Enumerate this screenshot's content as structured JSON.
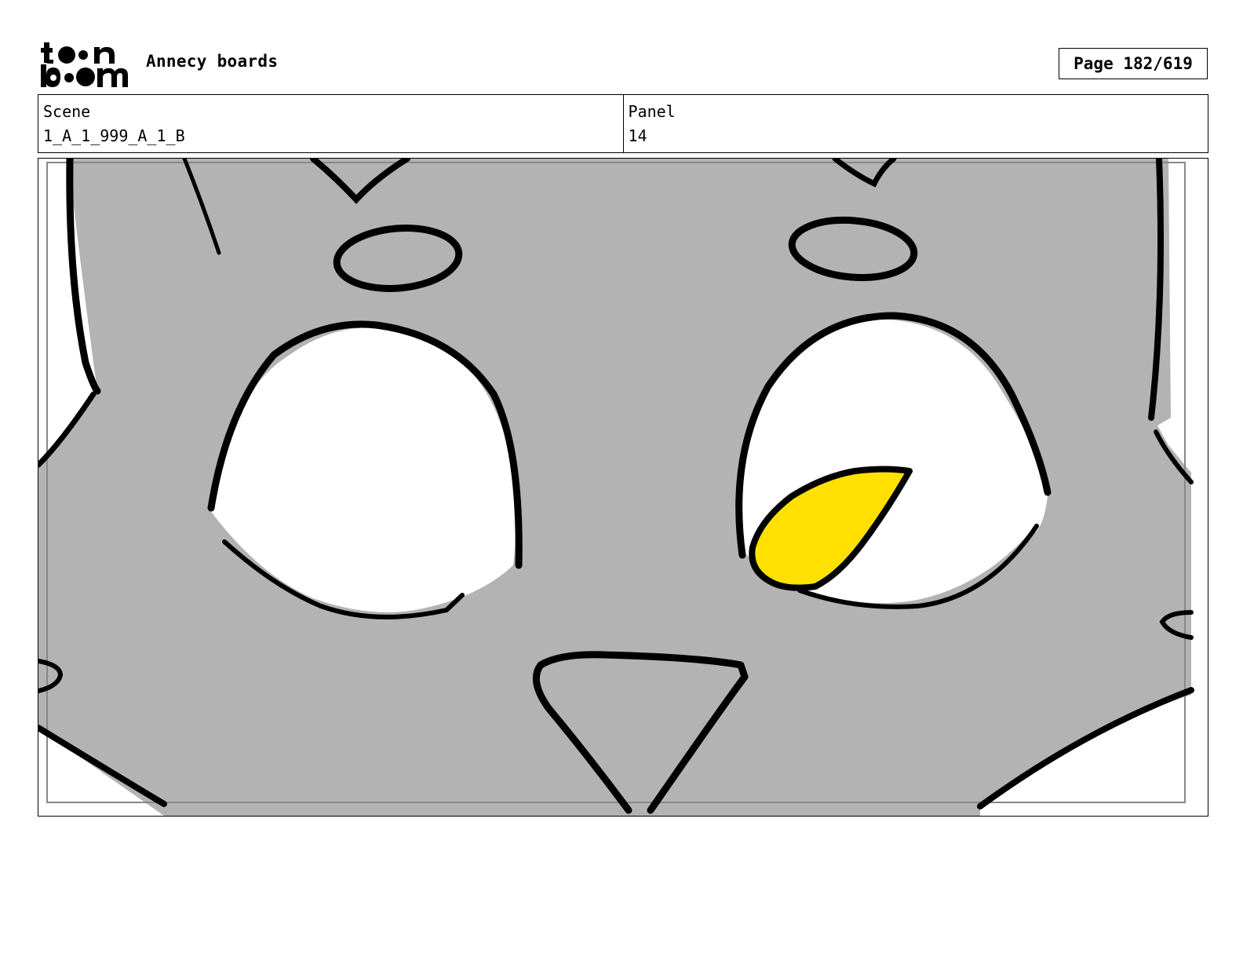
{
  "header": {
    "logo_text": "toon boom",
    "title": "Annecy boards",
    "page_label": "Page 182/619"
  },
  "info": {
    "scene_label": "Scene",
    "scene_value": "1_A_1_999_A_1_B",
    "panel_label": "Panel",
    "panel_value": "14"
  },
  "panel_image": {
    "icon": "storyboard-drawing",
    "colors": {
      "face": "#b3b3b3",
      "outline": "#000000",
      "eye": "#ffffff",
      "highlight": "#ffe000"
    }
  }
}
